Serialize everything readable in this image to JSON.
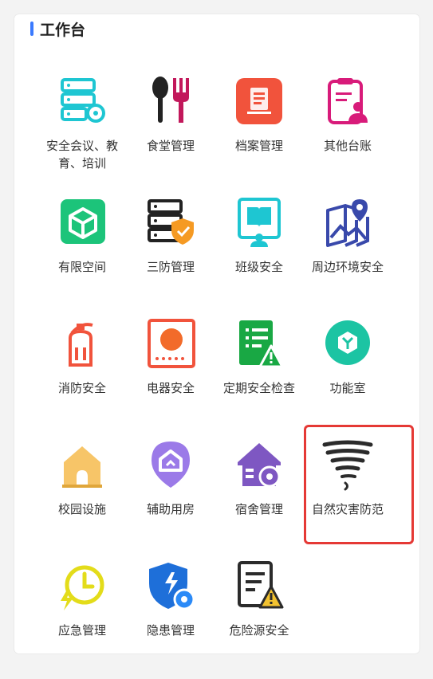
{
  "workbench": {
    "title": "工作台"
  },
  "items": [
    {
      "label": "安全会议、教育、培训",
      "icon": "server-gear-icon"
    },
    {
      "label": "食堂管理",
      "icon": "spoon-fork-icon"
    },
    {
      "label": "档案管理",
      "icon": "document-stack-icon"
    },
    {
      "label": "其他台账",
      "icon": "clipboard-user-icon"
    },
    {
      "label": "有限空间",
      "icon": "cube-icon"
    },
    {
      "label": "三防管理",
      "icon": "server-shield-icon"
    },
    {
      "label": "班级安全",
      "icon": "book-people-icon"
    },
    {
      "label": "周边环境安全",
      "icon": "map-pin-icon"
    },
    {
      "label": "消防安全",
      "icon": "fire-extinguisher-icon"
    },
    {
      "label": "电器安全",
      "icon": "appliance-icon"
    },
    {
      "label": "定期安全检查",
      "icon": "checklist-warning-icon"
    },
    {
      "label": "功能室",
      "icon": "room-cube-icon"
    },
    {
      "label": "校园设施",
      "icon": "house-icon"
    },
    {
      "label": "辅助用房",
      "icon": "house-pin-icon"
    },
    {
      "label": "宿舍管理",
      "icon": "house-gear-icon"
    },
    {
      "label": "自然灾害防范",
      "icon": "tornado-icon"
    },
    {
      "label": "应急管理",
      "icon": "clock-lightning-icon"
    },
    {
      "label": "隐患管理",
      "icon": "shield-gear-icon"
    },
    {
      "label": "危险源安全",
      "icon": "document-warning-icon"
    }
  ]
}
